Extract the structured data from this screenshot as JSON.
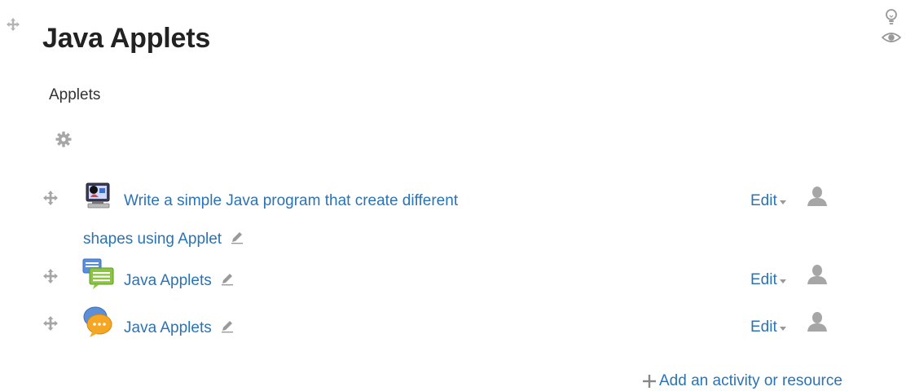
{
  "section": {
    "title": "Java Applets",
    "summary": "Applets"
  },
  "activities": [
    {
      "icon": "applet-monitor-icon",
      "title_line1": "Write a simple Java program that create different",
      "title_line2": "shapes using Applet",
      "edit_label": "Edit"
    },
    {
      "icon": "forum-icon",
      "title": "Java Applets",
      "edit_label": "Edit"
    },
    {
      "icon": "chat-icon",
      "title": "Java Applets",
      "edit_label": "Edit"
    }
  ],
  "add_activity_label": "Add an activity or resource",
  "colors": {
    "link": "#2a73b6",
    "icon_gray": "#999999",
    "title": "#222222"
  }
}
